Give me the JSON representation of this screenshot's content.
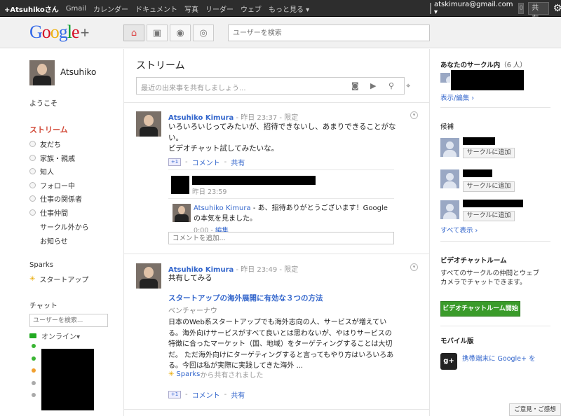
{
  "topbar": {
    "user": "+Atsuhikoさん",
    "links": [
      "Gmail",
      "カレンダー",
      "ドキュメント",
      "写真",
      "リーダー",
      "ウェブ",
      "もっと見る ▾"
    ],
    "email": "atskimura@gmail.com ▾",
    "notifications": "0",
    "share": "共有...",
    "gear": "⚙"
  },
  "header": {
    "logo": {
      "g1": "G",
      "g2": "o",
      "g3": "o",
      "g4": "g",
      "g5": "l",
      "g6": "e",
      "plus": "+"
    },
    "nav_icons": {
      "home": "⌂",
      "photos": "▣",
      "profile": "◉",
      "circles": "◎"
    },
    "search_placeholder": "ユーザーを検索"
  },
  "sidebar": {
    "profile_name": "Atsuhiko",
    "welcome": "ようこそ",
    "stream": "ストリーム",
    "circles": [
      "友だち",
      "家族・親戚",
      "知人",
      "フォロー中",
      "仕事の関係者",
      "仕事仲間"
    ],
    "extra": [
      "サークル外から",
      "お知らせ"
    ],
    "sparks_title": "Sparks",
    "sparks_item": "スタートアップ",
    "chat_title": "チャット",
    "chat_search_placeholder": "ユーザーを検索...",
    "online": "オンライン▾",
    "chat_dot_colors": [
      "#3ab534",
      "#3ab534",
      "#f0a030",
      "#aaaaaa",
      "#aaaaaa"
    ]
  },
  "main": {
    "title": "ストリーム",
    "share_placeholder": "最近の出来事を共有しましょう...",
    "share_icons": {
      "camera": "◙",
      "video": "▶",
      "link": "⚲",
      "location": "⌖"
    },
    "posts": [
      {
        "author": "Atsuhiko Kimura",
        "meta": " - 昨日 23:37 - 限定",
        "text": "いろいろいじってみたいが、招待できないし、あまりできることがない。\nビデオチャット試してみたいな。",
        "plus1": "+1",
        "comment": "コメント",
        "share": "共有",
        "comments": [
          {
            "time": "昨日 23:59"
          },
          {
            "author": "Atsuhiko Kimura",
            "text": " - あ、招待ありがとうございます！Googleの本気を見ました。",
            "time": "0:00",
            "edit": "編集"
          }
        ],
        "comment_placeholder": "コメントを追加..."
      },
      {
        "author": "Atsuhiko Kimura",
        "meta": " - 昨日 23:49 - 限定",
        "text": "共有してみる",
        "link_title": "スタートアップの海外展開に有効な３つの方法",
        "link_source": "ベンチャーナウ",
        "link_body": "日本のWeb系スタートアップでも海外志向の人、サービスが増えている。海外向けサービスがすべて良いとは思わないが、やはりサービスの特徴に合ったマーケット（国、地域）をターゲティングすることは大切だ。 ただ海外向けにターゲティングすると言ってもやり方はいろいろある。今回は私が実際に実践してきた海外 ...",
        "sparks_source": "Sparks",
        "sparks_suffix": " から共有されました",
        "plus1": "+1",
        "comment": "コメント",
        "share": "共有"
      }
    ]
  },
  "right": {
    "in_circles_title": "あなたのサークル内",
    "in_circles_count": "（6 人）",
    "view_edit": "表示/編集 ›",
    "suggestions_title": "候補",
    "add_to_circle": "サークルに追加",
    "show_all": "すべて表示 ›",
    "videochat_title": "ビデオチャットルーム",
    "videochat_desc": "すべてのサークルの仲間とウェブカメラでチャットできます。",
    "videochat_button": "ビデオチャットルーム開始",
    "mobile_title": "モバイル版",
    "mobile_icon": "g+",
    "mobile_text": "携帯端末に Google+ を",
    "feedback": "ご意見・ご感想"
  }
}
